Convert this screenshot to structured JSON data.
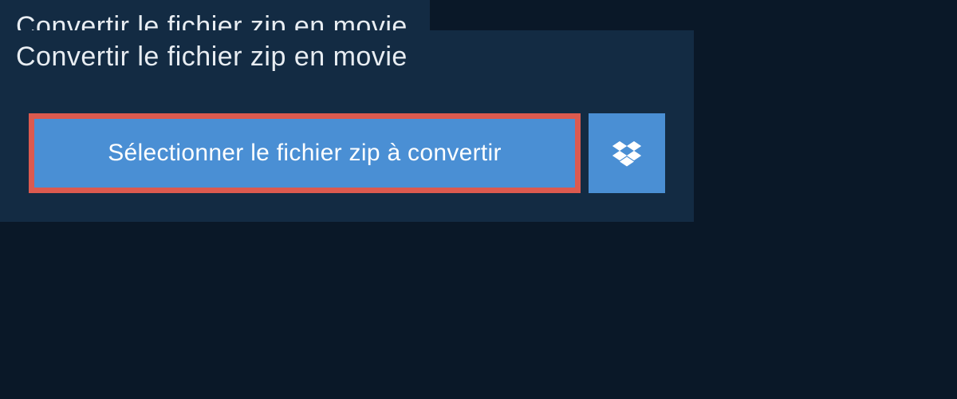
{
  "header": {
    "title": "Convertir le fichier zip en movie"
  },
  "actions": {
    "select_file_label": "Sélectionner le fichier zip à convertir"
  },
  "colors": {
    "body_bg": "#0a1828",
    "panel_bg": "#132b43",
    "button_bg": "#4a8fd4",
    "button_border": "#dc5a4f",
    "text_light": "#e8edf2",
    "text_white": "#ffffff"
  }
}
